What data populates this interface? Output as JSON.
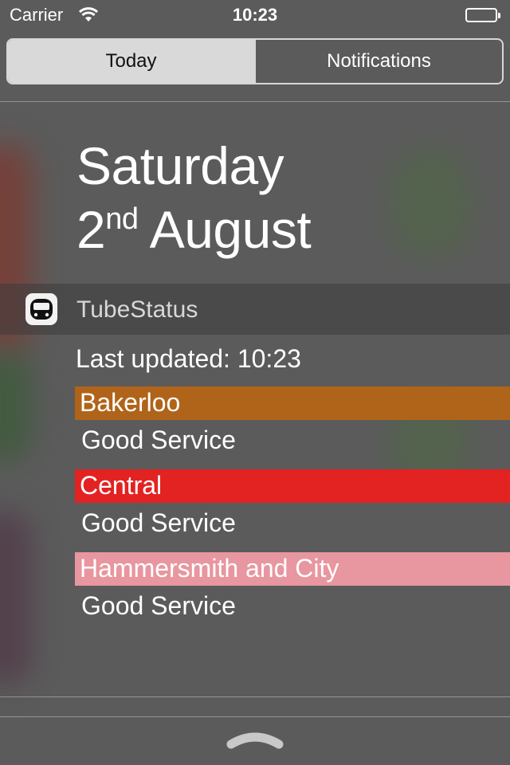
{
  "status_bar": {
    "carrier": "Carrier",
    "time": "10:23"
  },
  "segmented": {
    "today": "Today",
    "notifications": "Notifications"
  },
  "date": {
    "weekday": "Saturday",
    "day": "2",
    "ordinal": "nd",
    "month": "August"
  },
  "widget": {
    "title": "TubeStatus",
    "last_updated": "Last updated: 10:23",
    "lines": [
      {
        "name": "Bakerloo",
        "status": "Good Service",
        "color": "#b06419"
      },
      {
        "name": "Central",
        "status": "Good Service",
        "color": "#e32222"
      },
      {
        "name": "Hammersmith and City",
        "status": "Good Service",
        "color": "#e8969f"
      }
    ]
  }
}
